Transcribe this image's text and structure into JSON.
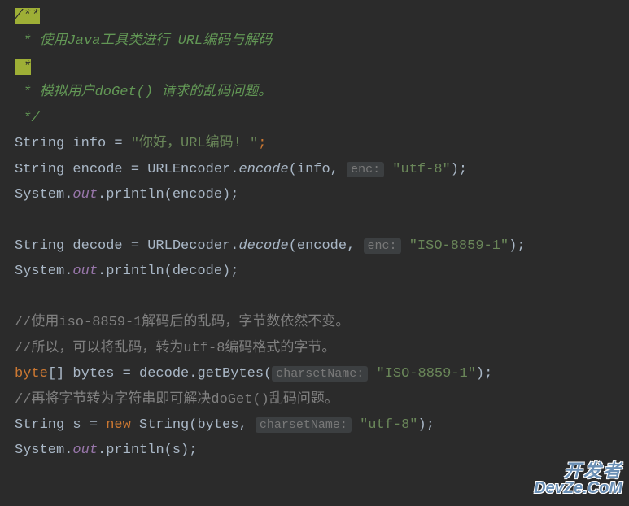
{
  "code": {
    "c1": "/**",
    "c2": " * 使用Java工具类进行 URL编码与解码",
    "c3": " *",
    "c4": " * 模拟用户doGet() 请求的乱码问题。",
    "c5": " */",
    "l1_a": "String info = ",
    "l1_b": "\"你好，URL编码! \"",
    "l1_c": ";",
    "l2_a": "String encode = URLEncoder.",
    "l2_b": "encode",
    "l2_c": "(info, ",
    "l2_hint": "enc:",
    "l2_d": " \"utf-8\"",
    "l2_e": ");",
    "l3_a": "System.",
    "l3_b": "out",
    "l3_c": ".println(encode);",
    "l4_a": "String decode = URLDecoder.",
    "l4_b": "decode",
    "l4_c": "(encode, ",
    "l4_hint": "enc:",
    "l4_d": " \"ISO-8859-1\"",
    "l4_e": ");",
    "l5_a": "System.",
    "l5_b": "out",
    "l5_c": ".println(decode);",
    "cc1": "//使用iso-8859-1解码后的乱码，字节数依然不变。",
    "cc2": "//所以，可以将乱码，转为utf-8编码格式的字节。",
    "l6_a": "byte",
    "l6_b": "[] bytes = decode.getBytes(",
    "l6_hint": "charsetName:",
    "l6_c": " \"ISO-8859-1\"",
    "l6_d": ");",
    "cc3": "//再将字节转为字符串即可解决doGet()乱码问题。",
    "l7_a": "String s = ",
    "l7_b": "new ",
    "l7_c": "String(bytes, ",
    "l7_hint": "charsetName:",
    "l7_d": " \"utf-8\"",
    "l7_e": ");",
    "l8_a": "System.",
    "l8_b": "out",
    "l8_c": ".println(s);"
  },
  "watermark": {
    "line1": "开发者",
    "line2": "DevZe.CoM"
  }
}
